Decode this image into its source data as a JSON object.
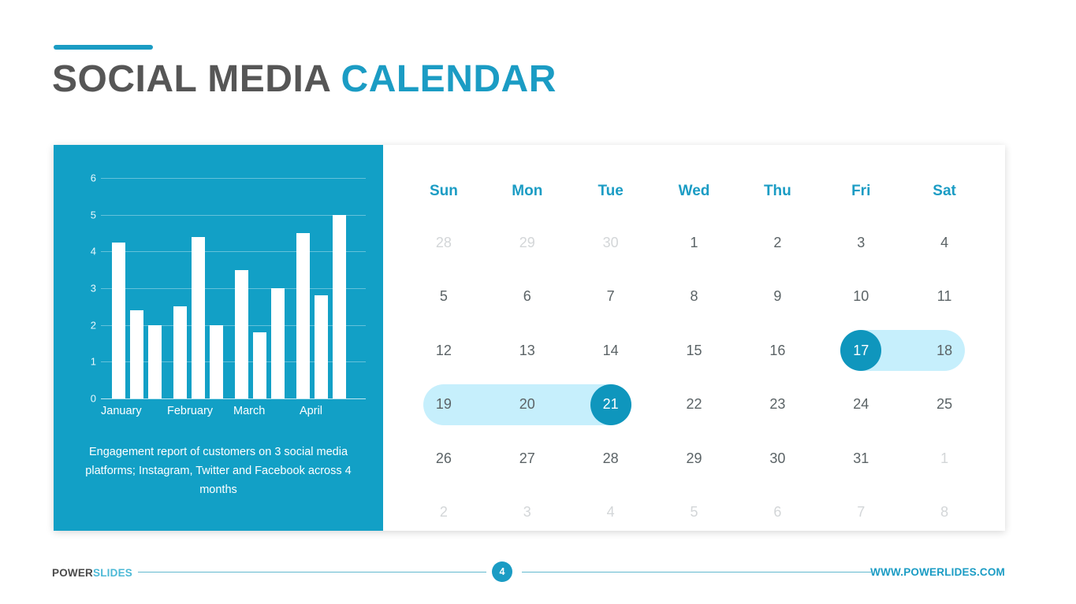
{
  "title": {
    "part_dark": "SOCIAL MEDIA ",
    "part_blue": "CALENDAR"
  },
  "colors": {
    "brand_blue": "#1b9cc4",
    "panel_blue": "#12a0c6",
    "selected_circle": "#0f96bd",
    "range_highlight": "#c6effc",
    "title_dark": "#565656",
    "day_text": "#5b6366",
    "muted_text": "#d3d6d8"
  },
  "chart_data": {
    "type": "bar",
    "title": "",
    "xlabel": "",
    "ylabel": "",
    "ylim": [
      0,
      6
    ],
    "yticks": [
      0,
      1,
      2,
      3,
      4,
      5,
      6
    ],
    "grid": true,
    "legend": "none",
    "categories": [
      "January",
      "February",
      "March",
      "April"
    ],
    "series": [
      {
        "name": "Instagram",
        "values": [
          4.25,
          2.5,
          3.5,
          4.5
        ]
      },
      {
        "name": "Twitter",
        "values": [
          2.4,
          4.4,
          1.8,
          2.8
        ]
      },
      {
        "name": "Facebook",
        "values": [
          2.0,
          2.0,
          3.0,
          5.0
        ]
      }
    ],
    "caption": "Engagement report of customers on 3 social media platforms; Instagram, Twitter and Facebook across 4 months"
  },
  "calendar": {
    "day_headers": [
      "Sun",
      "Mon",
      "Tue",
      "Wed",
      "Thu",
      "Fri",
      "Sat"
    ],
    "weeks": [
      [
        {
          "label": "28",
          "state": "muted"
        },
        {
          "label": "29",
          "state": "muted"
        },
        {
          "label": "30",
          "state": "muted"
        },
        {
          "label": "1",
          "state": "normal"
        },
        {
          "label": "2",
          "state": "normal"
        },
        {
          "label": "3",
          "state": "normal"
        },
        {
          "label": "4",
          "state": "normal"
        }
      ],
      [
        {
          "label": "5",
          "state": "normal"
        },
        {
          "label": "6",
          "state": "normal"
        },
        {
          "label": "7",
          "state": "normal"
        },
        {
          "label": "8",
          "state": "normal"
        },
        {
          "label": "9",
          "state": "normal"
        },
        {
          "label": "10",
          "state": "normal"
        },
        {
          "label": "11",
          "state": "normal"
        }
      ],
      [
        {
          "label": "12",
          "state": "normal"
        },
        {
          "label": "13",
          "state": "normal"
        },
        {
          "label": "14",
          "state": "normal"
        },
        {
          "label": "15",
          "state": "normal"
        },
        {
          "label": "16",
          "state": "normal"
        },
        {
          "label": "17",
          "state": "selected"
        },
        {
          "label": "18",
          "state": "in-range"
        }
      ],
      [
        {
          "label": "19",
          "state": "in-range"
        },
        {
          "label": "20",
          "state": "in-range"
        },
        {
          "label": "21",
          "state": "selected"
        },
        {
          "label": "22",
          "state": "normal"
        },
        {
          "label": "23",
          "state": "normal"
        },
        {
          "label": "24",
          "state": "normal"
        },
        {
          "label": "25",
          "state": "normal"
        }
      ],
      [
        {
          "label": "26",
          "state": "normal"
        },
        {
          "label": "27",
          "state": "normal"
        },
        {
          "label": "28",
          "state": "normal"
        },
        {
          "label": "29",
          "state": "normal"
        },
        {
          "label": "30",
          "state": "normal"
        },
        {
          "label": "31",
          "state": "normal"
        },
        {
          "label": "1",
          "state": "muted"
        }
      ],
      [
        {
          "label": "2",
          "state": "muted"
        },
        {
          "label": "3",
          "state": "muted"
        },
        {
          "label": "4",
          "state": "muted"
        },
        {
          "label": "5",
          "state": "muted"
        },
        {
          "label": "6",
          "state": "muted"
        },
        {
          "label": "7",
          "state": "muted"
        },
        {
          "label": "8",
          "state": "muted"
        }
      ]
    ]
  },
  "footer": {
    "brand_part1": "POWER",
    "brand_part2": "SLIDES",
    "page_number": "4",
    "url": "WWW.POWERLIDES.COM"
  }
}
